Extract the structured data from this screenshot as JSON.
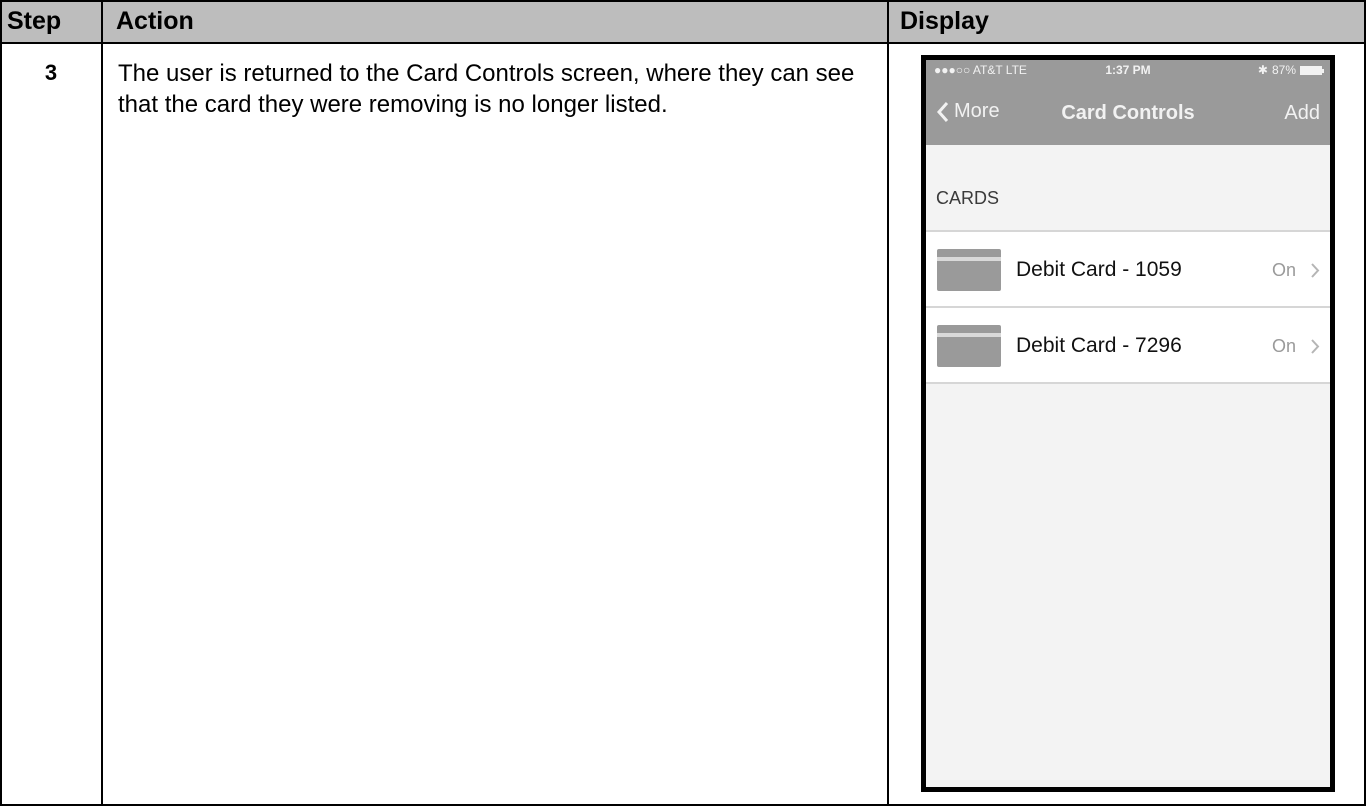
{
  "table": {
    "headers": {
      "step": "Step",
      "action": "Action",
      "display": "Display"
    },
    "row": {
      "step": "3",
      "action": "The user is returned to the Card Controls screen, where they can see that the card they were removing is no longer listed."
    }
  },
  "phone": {
    "status_bar": {
      "carrier": "●●●○○ AT&T  LTE",
      "time": "1:37 PM",
      "battery": "87%",
      "bluetooth_icon": "bluetooth-icon"
    },
    "nav": {
      "back_label": "More",
      "title": "Card Controls",
      "add_label": "Add"
    },
    "section_label": "CARDS",
    "cards": [
      {
        "name": "Debit Card - 1059",
        "status": "On"
      },
      {
        "name": "Debit Card - 7296",
        "status": "On"
      }
    ]
  },
  "colors": {
    "header_bg": "#bdbdbd",
    "phone_bar": "#9a9a9a",
    "phone_bg": "#f3f3f3"
  }
}
